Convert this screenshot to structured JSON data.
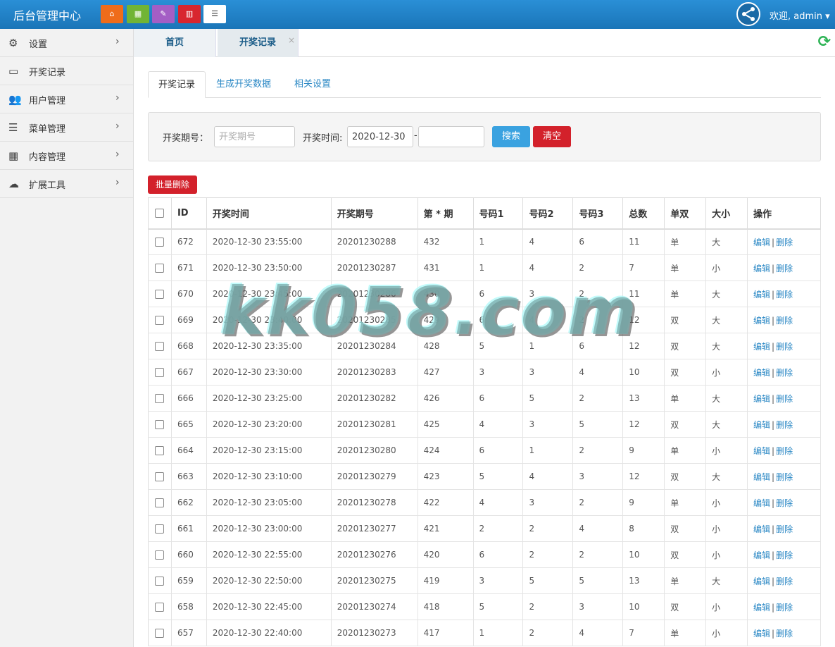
{
  "topbar": {
    "brand": "后台管理中心",
    "icons": [
      "home-icon",
      "grid-icon",
      "edit-icon",
      "trash-icon",
      "list-icon"
    ],
    "welcome": "欢迎, admin ▾"
  },
  "sidebar": {
    "items": [
      {
        "label": "设置",
        "icon": "gears-icon",
        "has_children": true
      },
      {
        "label": "开奖记录",
        "icon": "monitor-icon",
        "has_children": false
      },
      {
        "label": "用户管理",
        "icon": "users-icon",
        "has_children": true
      },
      {
        "label": "菜单管理",
        "icon": "list-icon",
        "has_children": true
      },
      {
        "label": "内容管理",
        "icon": "grid-icon",
        "has_children": true
      },
      {
        "label": "扩展工具",
        "icon": "cloud-icon",
        "has_children": true
      }
    ]
  },
  "page_tabs": {
    "tab1": "首页",
    "tab2": "开奖记录",
    "close": "×",
    "refresh": "⟳"
  },
  "inner_tabs": {
    "active": "开奖记录",
    "tab2": "生成开奖数据",
    "tab3": "相关设置"
  },
  "search": {
    "period_label": "开奖期号：",
    "period_placeholder": "开奖期号",
    "time_label": "开奖时间:",
    "time_from": "2020-12-30",
    "time_sep": "-",
    "time_to": "",
    "search_btn": "搜索",
    "clear_btn": "清空"
  },
  "batch_delete": "批量删除",
  "table": {
    "headers": [
      "ID",
      "开奖时间",
      "开奖期号",
      "第 * 期",
      "号码1",
      "号码2",
      "号码3",
      "总数",
      "单双",
      "大小",
      "操作"
    ],
    "edit_label": "编辑",
    "sep": "|",
    "delete_label": "删除",
    "rows": [
      [
        "672",
        "2020-12-30 23:55:00",
        "20201230288",
        "432",
        "1",
        "4",
        "6",
        "11",
        "单",
        "大"
      ],
      [
        "671",
        "2020-12-30 23:50:00",
        "20201230287",
        "431",
        "1",
        "4",
        "2",
        "7",
        "单",
        "小"
      ],
      [
        "670",
        "2020-12-30 23:45:00",
        "20201230286",
        "430",
        "6",
        "3",
        "2",
        "11",
        "单",
        "大"
      ],
      [
        "669",
        "2020-12-30 23:40:00",
        "20201230285",
        "429",
        "6",
        "4",
        "2",
        "12",
        "双",
        "大"
      ],
      [
        "668",
        "2020-12-30 23:35:00",
        "20201230284",
        "428",
        "5",
        "1",
        "6",
        "12",
        "双",
        "大"
      ],
      [
        "667",
        "2020-12-30 23:30:00",
        "20201230283",
        "427",
        "3",
        "3",
        "4",
        "10",
        "双",
        "小"
      ],
      [
        "666",
        "2020-12-30 23:25:00",
        "20201230282",
        "426",
        "6",
        "5",
        "2",
        "13",
        "单",
        "大"
      ],
      [
        "665",
        "2020-12-30 23:20:00",
        "20201230281",
        "425",
        "4",
        "3",
        "5",
        "12",
        "双",
        "大"
      ],
      [
        "664",
        "2020-12-30 23:15:00",
        "20201230280",
        "424",
        "6",
        "1",
        "2",
        "9",
        "单",
        "小"
      ],
      [
        "663",
        "2020-12-30 23:10:00",
        "20201230279",
        "423",
        "5",
        "4",
        "3",
        "12",
        "双",
        "大"
      ],
      [
        "662",
        "2020-12-30 23:05:00",
        "20201230278",
        "422",
        "4",
        "3",
        "2",
        "9",
        "单",
        "小"
      ],
      [
        "661",
        "2020-12-30 23:00:00",
        "20201230277",
        "421",
        "2",
        "2",
        "4",
        "8",
        "双",
        "小"
      ],
      [
        "660",
        "2020-12-30 22:55:00",
        "20201230276",
        "420",
        "6",
        "2",
        "2",
        "10",
        "双",
        "小"
      ],
      [
        "659",
        "2020-12-30 22:50:00",
        "20201230275",
        "419",
        "3",
        "5",
        "5",
        "13",
        "单",
        "大"
      ],
      [
        "658",
        "2020-12-30 22:45:00",
        "20201230274",
        "418",
        "5",
        "2",
        "3",
        "10",
        "双",
        "小"
      ],
      [
        "657",
        "2020-12-30 22:40:00",
        "20201230273",
        "417",
        "1",
        "2",
        "4",
        "7",
        "单",
        "小"
      ]
    ]
  },
  "watermark": "kk058.com",
  "colors": {
    "topbar": "#1b7cc1",
    "link": "#2b88c5",
    "danger": "#d3212b",
    "primary": "#3aa2e0"
  }
}
